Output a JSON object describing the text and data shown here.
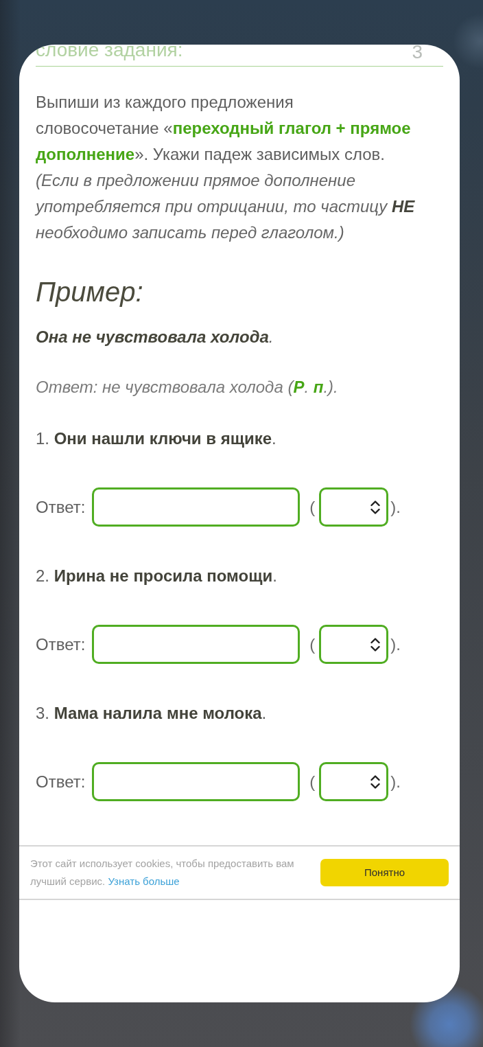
{
  "section_header": {
    "title": "словие задания:",
    "points": "3"
  },
  "instruction": "Выпиши из каждого предложения словосочетание «**переходный глагол + прямое дополнение**». Укажи падеж зависимых слов.",
  "note": "(Если в предложении прямое дополнение употребляется при отрицании, то частицу **НЕ** необходимо записать перед глаголом.)",
  "example": {
    "heading": "Пример:",
    "sentence": "**Она не чувствовала холода**.",
    "answer": "Ответ: не чувствовала холода (**Р**. **п**.)."
  },
  "tasks": [
    {
      "text": "1. **Они нашли ключи в ящике**.",
      "answer_label": "Ответ:",
      "paren_open": "(",
      "paren_close": ")."
    },
    {
      "text": "2. **Ирина не просила помощи**.",
      "answer_label": "Ответ:",
      "paren_open": "(",
      "paren_close": ")."
    },
    {
      "text": "3. **Мама налила мне молока**.",
      "answer_label": "Ответ:",
      "paren_open": "(",
      "paren_close": ")."
    }
  ],
  "cookie_banner": {
    "text": "Этот сайт использует cookies, чтобы предоставить вам лучший сервис.",
    "link": "Узнать больше",
    "button": "Понятно"
  }
}
